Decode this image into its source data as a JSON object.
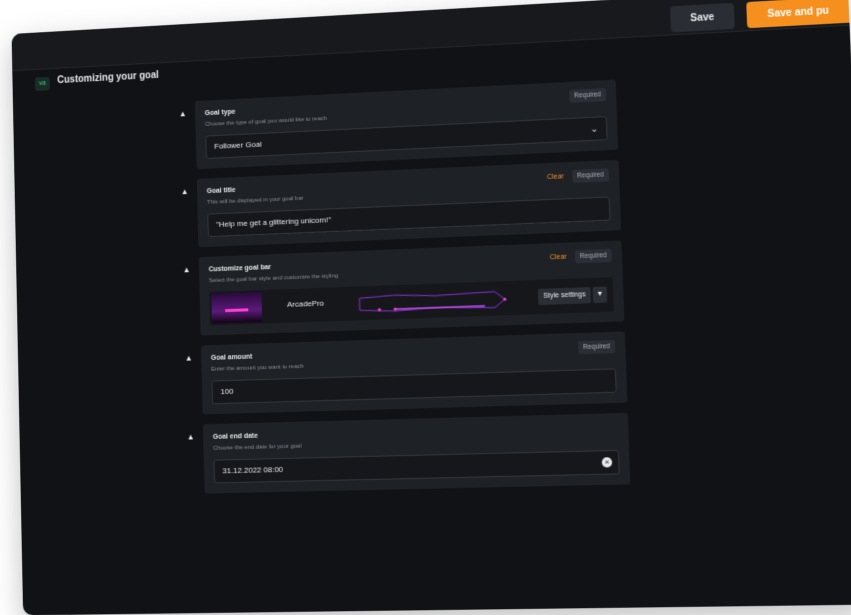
{
  "header": {
    "badge": "va",
    "title": "Customizing your goal",
    "save_label": "Save",
    "publish_label": "Save and pu"
  },
  "sections": [
    {
      "label": "Goal type",
      "description": "Choose the type of goal you would like to reach",
      "required": "Required",
      "value": "Follower Goal"
    },
    {
      "label": "Goal title",
      "description": "This will be displayed in your goal bar",
      "clear": "Clear",
      "required": "Required",
      "value": "\"Help me get a glittering unicorn!\""
    },
    {
      "label": "Customize goal bar",
      "description": "Select the goal bar style and customize the styling",
      "clear": "Clear",
      "required": "Required",
      "style_name": "ArcadePro",
      "style_settings": "Style settings"
    },
    {
      "label": "Goal amount",
      "description": "Enter the amount you want to reach",
      "required": "Required",
      "value": "100"
    },
    {
      "label": "Goal end date",
      "description": "Choose the end date for your goal",
      "value": "31.12.2022 08:00"
    }
  ],
  "colors": {
    "accent": "#f5901f",
    "background": "#101215",
    "card": "#1e2126"
  }
}
